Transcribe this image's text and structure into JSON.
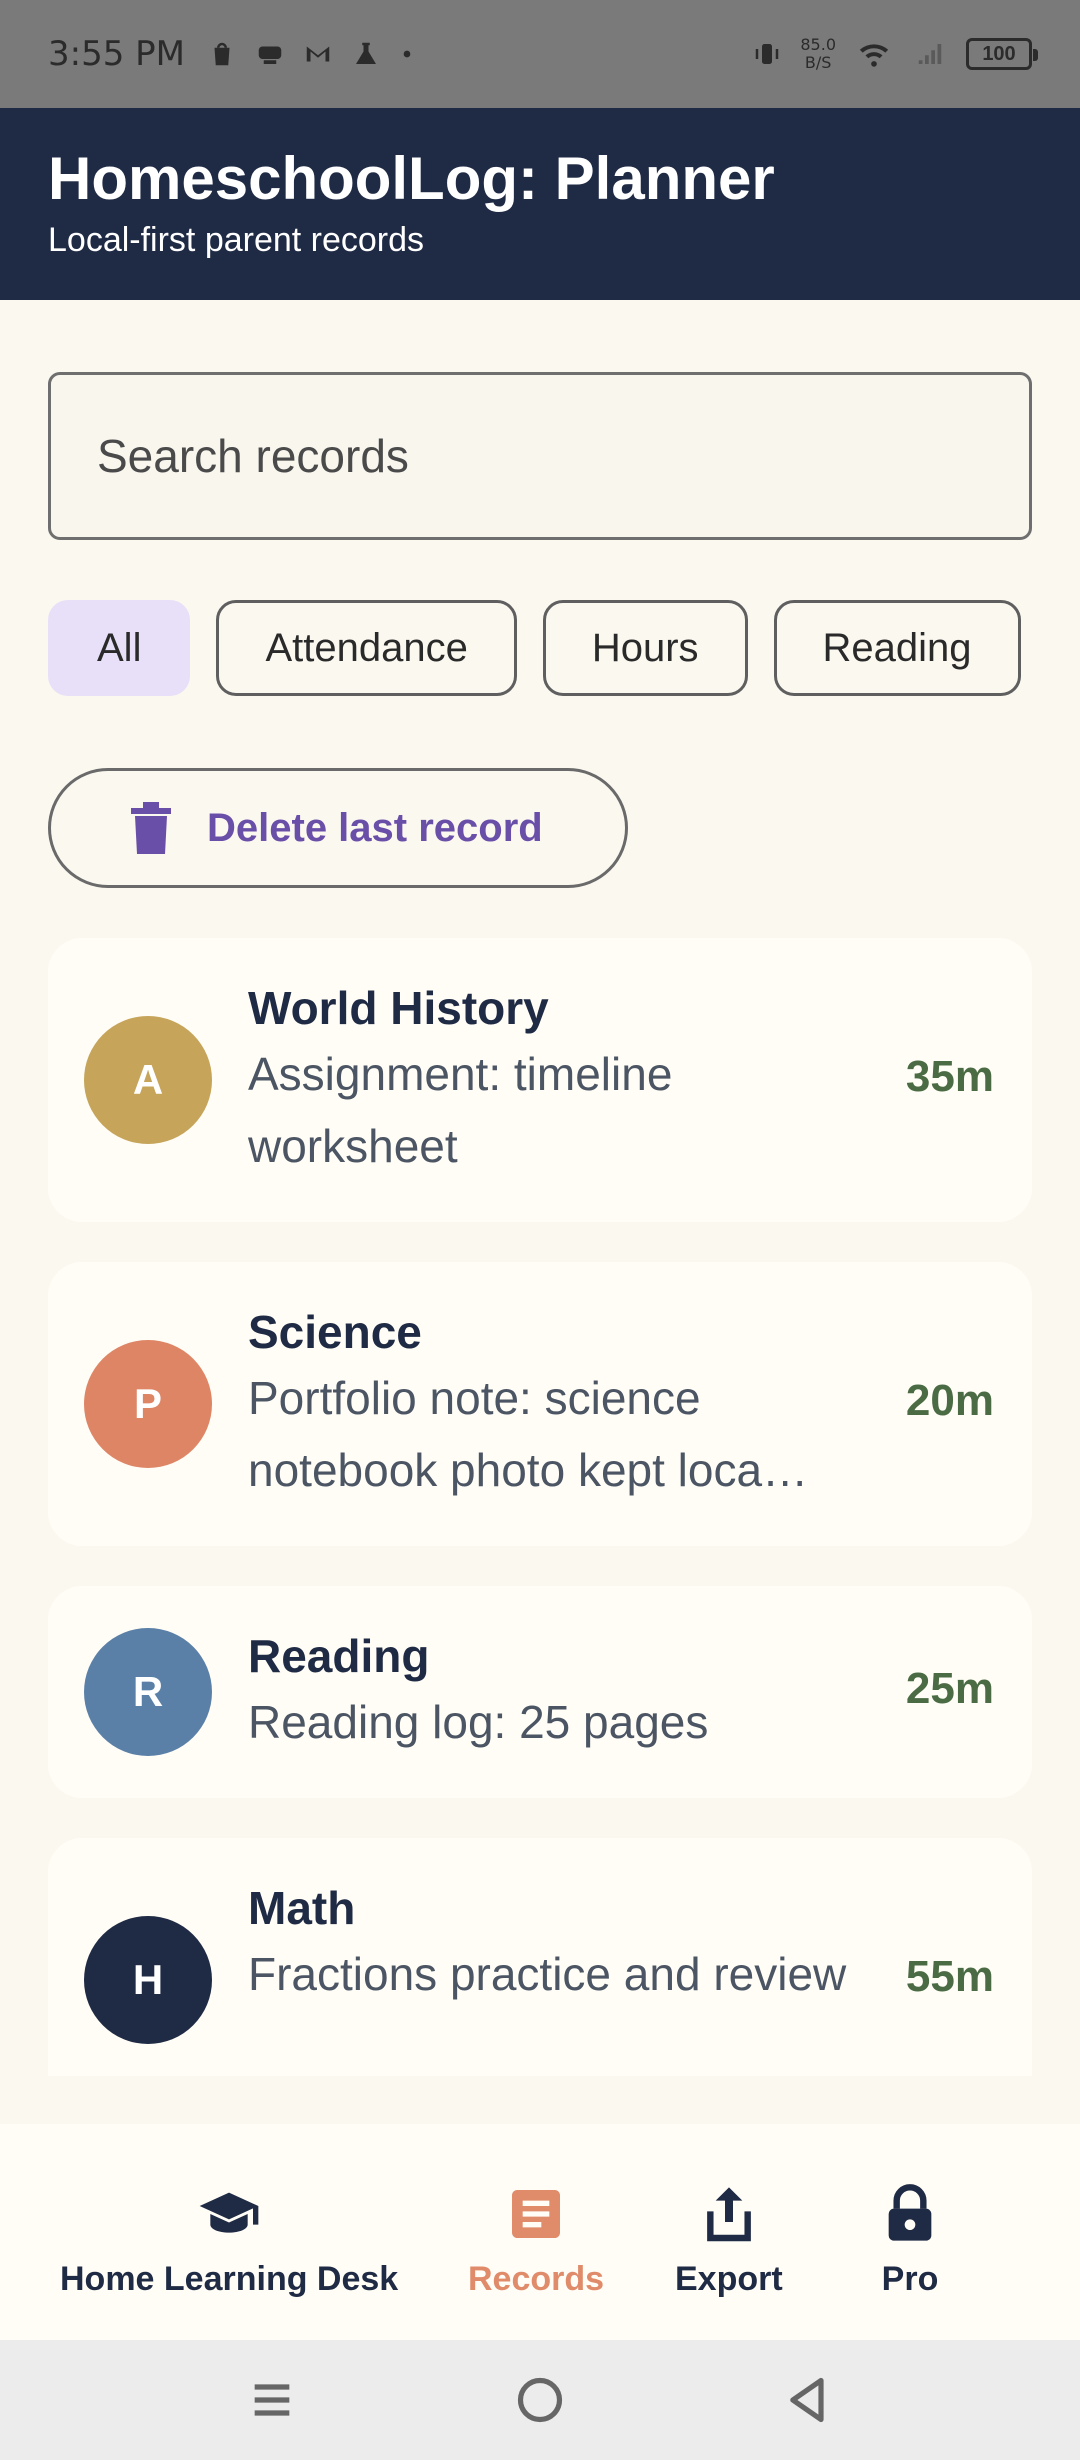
{
  "status_bar": {
    "time": "3:55 PM",
    "net_speed_value": "85.0",
    "net_speed_unit": "B/S",
    "battery": "100"
  },
  "header": {
    "title": "HomeschoolLog: Planner",
    "subtitle": "Local-first parent records"
  },
  "search": {
    "placeholder": "Search records",
    "value": ""
  },
  "filters": {
    "chips": [
      {
        "label": "All",
        "selected": true
      },
      {
        "label": "Attendance",
        "selected": false
      },
      {
        "label": "Hours",
        "selected": false
      },
      {
        "label": "Reading",
        "selected": false
      }
    ]
  },
  "actions": {
    "delete_last_label": "Delete last record"
  },
  "records": [
    {
      "initial": "A",
      "title": "World History",
      "description": "Assignment: timeline worksheet",
      "duration": "35m",
      "color": "#c6a45a"
    },
    {
      "initial": "P",
      "title": "Science",
      "description": "Portfolio note: science notebook photo kept loca…",
      "duration": "20m",
      "color": "#de8566"
    },
    {
      "initial": "R",
      "title": "Reading",
      "description": "Reading log: 25 pages",
      "duration": "25m",
      "color": "#5b80a8"
    },
    {
      "initial": "H",
      "title": "Math",
      "description": "Fractions practice and review",
      "duration": "55m",
      "color": "#1f2a44"
    }
  ],
  "bottom_nav": {
    "items": [
      {
        "label": "Home Learning Desk",
        "icon": "graduation-cap-icon"
      },
      {
        "label": "Records",
        "icon": "records-icon",
        "active": true
      },
      {
        "label": "Export",
        "icon": "share-icon"
      },
      {
        "label": "Pro",
        "icon": "lock-icon"
      }
    ]
  },
  "colors": {
    "header_bg": "#1f2a44",
    "accent_active": "#e08b6a",
    "delete_text": "#6a4fa8",
    "duration_text": "#4a6b43",
    "selected_chip_bg": "#e7e0f8"
  }
}
